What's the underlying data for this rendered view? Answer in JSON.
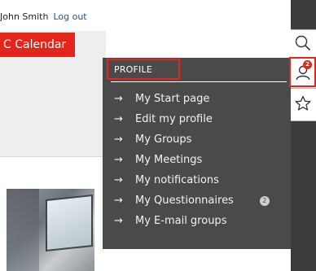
{
  "user": {
    "name": "John Smith",
    "logout_label": "Log out"
  },
  "calendar_button": {
    "label": "C Calendar"
  },
  "menu": {
    "header": "PROFILE",
    "items": [
      {
        "label": "My Start page"
      },
      {
        "label": "Edit my profile"
      },
      {
        "label": "My Groups"
      },
      {
        "label": "My Meetings"
      },
      {
        "label": "My notifications"
      },
      {
        "label": "My Questionnaires",
        "badge": "2"
      },
      {
        "label": "My E-mail groups"
      }
    ],
    "arrow": "→"
  },
  "sidebar": {
    "icons": [
      "search-icon",
      "user-icon",
      "star-icon"
    ],
    "user_badge": "2"
  },
  "colors": {
    "accent": "#e4251b",
    "menu_bg": "#4a4a4a",
    "sidebar_bg": "#3b3b3b",
    "link": "#2a4b9a"
  }
}
